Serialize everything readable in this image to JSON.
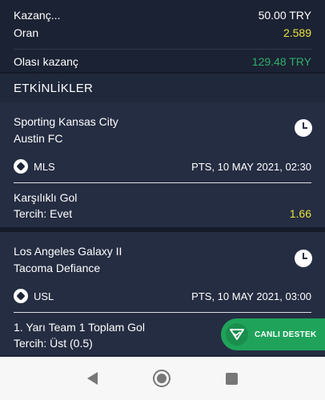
{
  "summary": {
    "stake_label": "Kazanç...",
    "stake_value": "50.00 TRY",
    "odds_label": "Oran",
    "odds_value": "2.589",
    "potential_label": "Olası kazanç",
    "potential_value": "129.48 TRY"
  },
  "section_title": "ETKİNLİKLER",
  "events": [
    {
      "team1": "Sporting Kansas City",
      "team2": "Austin FC",
      "league": "MLS",
      "datetime": "PTS, 10 MAY 2021, 02:30",
      "market": "Karşılıklı Gol",
      "pick": "Tercih: Evet",
      "odds": "1.66"
    },
    {
      "team1": "Los Angeles Galaxy II",
      "team2": "Tacoma Defiance",
      "league": "USL",
      "datetime": "PTS, 10 MAY 2021, 03:00",
      "market": "1. Yarı Team 1 Toplam Gol",
      "pick": "Tercih: Üst (0.5)",
      "odds": ""
    }
  ],
  "support_label": "CANLI DESTEK",
  "colors": {
    "background": "#1e2538",
    "odds_yellow": "#e8e23c",
    "win_green": "#2fae6a",
    "support_green": "#1fa35a"
  },
  "icons": [
    "clock-icon",
    "soccer-ball-icon",
    "live-support-icon",
    "back-icon",
    "home-icon",
    "recent-apps-icon"
  ]
}
